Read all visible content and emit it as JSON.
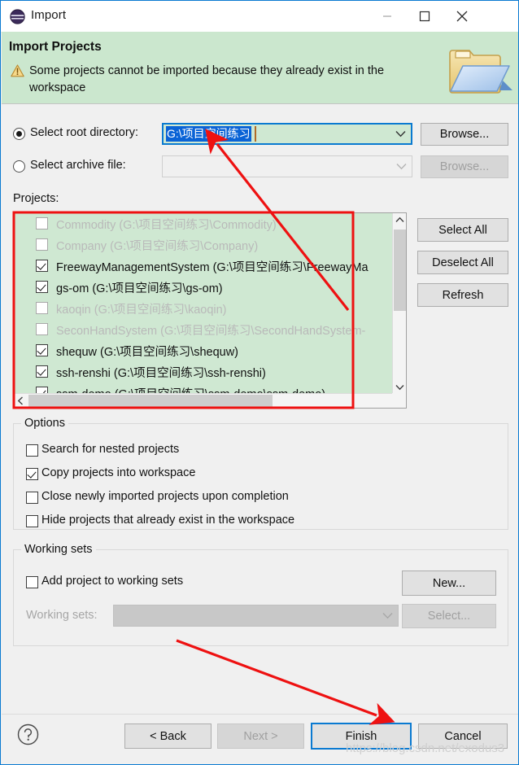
{
  "window": {
    "title": "Import",
    "icon": "eclipse-logo-icon",
    "minimize_label": "—",
    "maximize_label": "□",
    "close_label": "✕"
  },
  "banner": {
    "title": "Import Projects",
    "message": "Some projects cannot be imported because they already exist in the workspace",
    "warning_icon": "warning-triangle-icon",
    "decoration_icon": "import-folder-icon",
    "background_color": "#cbe7ce"
  },
  "source": {
    "root_directory": {
      "label": "Select root directory:",
      "selected": true,
      "value": "G:\\项目空间练习",
      "browse_label": "Browse...",
      "browse_enabled": true
    },
    "archive_file": {
      "label": "Select archive file:",
      "selected": false,
      "value": "",
      "browse_label": "Browse...",
      "browse_enabled": false
    }
  },
  "projects": {
    "label": "Projects:",
    "rows": [
      {
        "name": "Commodity (G:\\项目空间练习\\Commodity)",
        "checked": false,
        "enabled": false
      },
      {
        "name": "Company (G:\\项目空间练习\\Company)",
        "checked": false,
        "enabled": false
      },
      {
        "name": "FreewayManagementSystem (G:\\项目空间练习\\FreewayMa",
        "checked": true,
        "enabled": true
      },
      {
        "name": "gs-om (G:\\项目空间练习\\gs-om)",
        "checked": true,
        "enabled": true
      },
      {
        "name": "kaoqin (G:\\项目空间练习\\kaoqin)",
        "checked": false,
        "enabled": false
      },
      {
        "name": "SeconHandSystem (G:\\项目空间练习\\SecondHandSystem-",
        "checked": false,
        "enabled": false
      },
      {
        "name": "shequw (G:\\项目空间练习\\shequw)",
        "checked": true,
        "enabled": true
      },
      {
        "name": "ssh-renshi (G:\\项目空间练习\\ssh-renshi)",
        "checked": true,
        "enabled": true
      },
      {
        "name": "ssm-demo (G:\\项目空间练习\\ssm-demo\\ssm-demo)",
        "checked": true,
        "enabled": true
      }
    ],
    "buttons": {
      "select_all": "Select All",
      "deselect_all": "Deselect All",
      "refresh": "Refresh"
    }
  },
  "options": {
    "title": "Options",
    "items": [
      {
        "label": "Search for nested projects",
        "checked": false
      },
      {
        "label": "Copy projects into workspace",
        "checked": true
      },
      {
        "label": "Close newly imported projects upon completion",
        "checked": false
      },
      {
        "label": "Hide projects that already exist in the workspace",
        "checked": false
      }
    ]
  },
  "working_sets": {
    "title": "Working sets",
    "add_checkbox": {
      "label": "Add project to working sets",
      "checked": false
    },
    "combo_label": "Working sets:",
    "combo_value": "",
    "new_label": "New...",
    "select_label": "Select..."
  },
  "footer": {
    "help_icon": "question-mark-icon",
    "back_label": "< Back",
    "back_enabled": true,
    "next_label": "Next >",
    "next_enabled": false,
    "finish_label": "Finish",
    "finish_default": true,
    "cancel_label": "Cancel"
  },
  "annotations": {
    "arrow_color": "#ee1111",
    "highlight_box_color": "#ee1111",
    "watermark": "https://blog.csdn.net/exodus3"
  }
}
